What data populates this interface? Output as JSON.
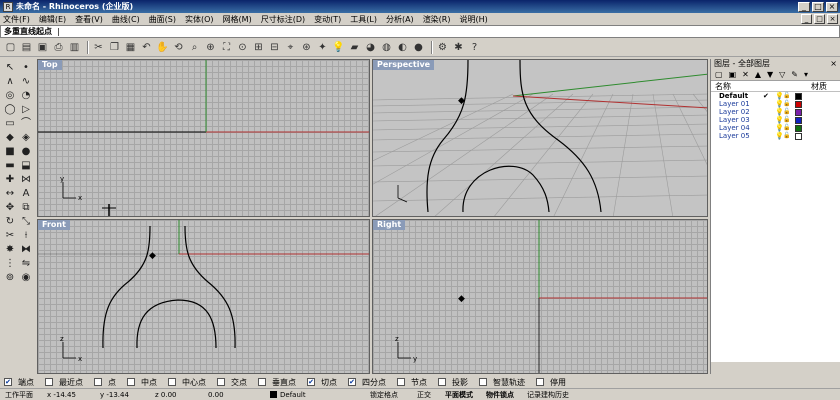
{
  "window": {
    "title": "未命名 - Rhinoceros (企业版)",
    "app_icon": "rhino-app-icon",
    "buttons": [
      "_",
      "□",
      "×"
    ]
  },
  "menu": {
    "items": [
      "文件(F)",
      "编辑(E)",
      "查看(V)",
      "曲线(C)",
      "曲面(S)",
      "实体(O)",
      "网格(M)",
      "尺寸标注(D)",
      "变动(T)",
      "工具(L)",
      "分析(A)",
      "渲染(R)",
      "说明(H)"
    ],
    "mdi_buttons": [
      "_",
      "□",
      "×"
    ]
  },
  "command": {
    "prompt": "多重直线起点",
    "caret": "|"
  },
  "toolbar": {
    "icons": [
      {
        "name": "new-file-icon",
        "glyph": "▢"
      },
      {
        "name": "open-icon",
        "glyph": "▤"
      },
      {
        "name": "save-icon",
        "glyph": "▣"
      },
      {
        "name": "print-icon",
        "glyph": "⎙"
      },
      {
        "name": "import-icon",
        "glyph": "▥"
      },
      {
        "name": "sep",
        "glyph": ""
      },
      {
        "name": "cut-icon",
        "glyph": "✂"
      },
      {
        "name": "copy-icon",
        "glyph": "❐"
      },
      {
        "name": "paste-icon",
        "glyph": "▦"
      },
      {
        "name": "undo-icon",
        "glyph": "↶"
      },
      {
        "name": "pan-icon",
        "glyph": "✋"
      },
      {
        "name": "rotate-view-icon",
        "glyph": "⟲"
      },
      {
        "name": "zoom-icon",
        "glyph": "⌕"
      },
      {
        "name": "zoom-window-icon",
        "glyph": "⊕"
      },
      {
        "name": "zoom-extents-icon",
        "glyph": "⛶"
      },
      {
        "name": "zoom-selected-icon",
        "glyph": "⊙"
      },
      {
        "name": "viewport-settings-icon",
        "glyph": "⊞"
      },
      {
        "name": "four-view-icon",
        "glyph": "⊟"
      },
      {
        "name": "cplane-icon",
        "glyph": "⌖"
      },
      {
        "name": "select-icon",
        "glyph": "⊛"
      },
      {
        "name": "snap-icon",
        "glyph": "✦"
      },
      {
        "name": "light-icon",
        "glyph": "💡"
      },
      {
        "name": "layer-icon",
        "glyph": "▰"
      },
      {
        "name": "color-wheel-icon",
        "glyph": "◕"
      },
      {
        "name": "properties-icon",
        "glyph": "◍"
      },
      {
        "name": "render-icon",
        "glyph": "◐"
      },
      {
        "name": "shade-icon",
        "glyph": "●"
      },
      {
        "name": "sep",
        "glyph": ""
      },
      {
        "name": "options-icon",
        "glyph": "⚙"
      },
      {
        "name": "tools-icon",
        "glyph": "✱"
      },
      {
        "name": "help-icon",
        "glyph": "?"
      }
    ]
  },
  "left_tools": [
    {
      "name": "select-arrow-icon",
      "glyph": "↖"
    },
    {
      "name": "point-icon",
      "glyph": "•"
    },
    {
      "name": "polyline-icon",
      "glyph": "∧"
    },
    {
      "name": "curve-icon",
      "glyph": "∿"
    },
    {
      "name": "circle-icon",
      "glyph": "◎"
    },
    {
      "name": "arc-icon",
      "glyph": "◔"
    },
    {
      "name": "ellipse-icon",
      "glyph": "◯"
    },
    {
      "name": "polygon-icon",
      "glyph": "▷"
    },
    {
      "name": "rectangle-icon",
      "glyph": "▭"
    },
    {
      "name": "fillet-icon",
      "glyph": "⌒"
    },
    {
      "name": "surface-icon",
      "glyph": "◆"
    },
    {
      "name": "loft-icon",
      "glyph": "◈"
    },
    {
      "name": "box-icon",
      "glyph": "■"
    },
    {
      "name": "sphere-icon",
      "glyph": "●"
    },
    {
      "name": "cylinder-icon",
      "glyph": "▬"
    },
    {
      "name": "extrude-icon",
      "glyph": "⬓"
    },
    {
      "name": "boolean-union-icon",
      "glyph": "✚"
    },
    {
      "name": "mesh-icon",
      "glyph": "⋈"
    },
    {
      "name": "dimension-icon",
      "glyph": "↔"
    },
    {
      "name": "text-icon",
      "glyph": "A"
    },
    {
      "name": "move-icon",
      "glyph": "✥"
    },
    {
      "name": "copy-tool-icon",
      "glyph": "⧉"
    },
    {
      "name": "rotate-icon",
      "glyph": "↻"
    },
    {
      "name": "scale-icon",
      "glyph": "⤡"
    },
    {
      "name": "trim-icon",
      "glyph": "✂"
    },
    {
      "name": "split-icon",
      "glyph": "⟊"
    },
    {
      "name": "explode-icon",
      "glyph": "✸"
    },
    {
      "name": "join-icon",
      "glyph": "⧓"
    },
    {
      "name": "array-icon",
      "glyph": "⋮"
    },
    {
      "name": "mirror-icon",
      "glyph": "⇋"
    },
    {
      "name": "analyze-icon",
      "glyph": "⊚"
    },
    {
      "name": "render-tool-icon",
      "glyph": "◉"
    }
  ],
  "viewports": {
    "top": {
      "label": "Top",
      "axis_x": "x",
      "axis_y": "y"
    },
    "perspective": {
      "label": "Perspective"
    },
    "front": {
      "label": "Front",
      "axis_x": "x",
      "axis_y": "z"
    },
    "right": {
      "label": "Right",
      "axis_x": "y",
      "axis_y": "z"
    }
  },
  "layers": {
    "title": "图层 - 全部图层",
    "close": "×",
    "tool_glyphs": [
      "▢",
      "▣",
      "✕",
      "▲",
      "▼",
      "▽",
      "✎",
      "▾"
    ],
    "col_name": "名称",
    "col_material": "材质",
    "rows": [
      {
        "name": "Default",
        "current": true,
        "color": "#000000"
      },
      {
        "name": "Layer 01",
        "current": false,
        "color": "#cc0000"
      },
      {
        "name": "Layer 02",
        "current": false,
        "color": "#7a20a8"
      },
      {
        "name": "Layer 03",
        "current": false,
        "color": "#1020c0"
      },
      {
        "name": "Layer 04",
        "current": false,
        "color": "#107010"
      },
      {
        "name": "Layer 05",
        "current": false,
        "color": "#ffffff"
      }
    ],
    "check_glyph": "✔",
    "bulb_glyph": "💡",
    "lock_glyph": "🔓"
  },
  "osnaps": [
    {
      "label": "端点",
      "checked": true
    },
    {
      "label": "最近点",
      "checked": false
    },
    {
      "label": "点",
      "checked": false
    },
    {
      "label": "中点",
      "checked": false
    },
    {
      "label": "中心点",
      "checked": false
    },
    {
      "label": "交点",
      "checked": false
    },
    {
      "label": "垂直点",
      "checked": false
    },
    {
      "label": "切点",
      "checked": true
    },
    {
      "label": "四分点",
      "checked": true
    },
    {
      "label": "节点",
      "checked": false
    },
    {
      "label": "投影",
      "checked": false
    },
    {
      "label": "智慧轨迹",
      "checked": false
    },
    {
      "label": "停用",
      "checked": false
    }
  ],
  "status": {
    "cplane": "工作平面",
    "x": "x -14.45",
    "y": "y -13.44",
    "z": "z 0.00",
    "d": "0.00",
    "layer": "Default",
    "grid_snap": "锁定格点",
    "ortho": "正交",
    "planar": "平面模式",
    "osnap": "物件锁点",
    "history": "记录建构历史"
  },
  "colors": {
    "grid_bg": "#c0c0c0",
    "grid_line": "#a6a6a6",
    "x_axis": "#b03030",
    "y_axis": "#2e8b2e",
    "viewport_label_bg": "#8a9bb8",
    "curve": "#000000"
  }
}
